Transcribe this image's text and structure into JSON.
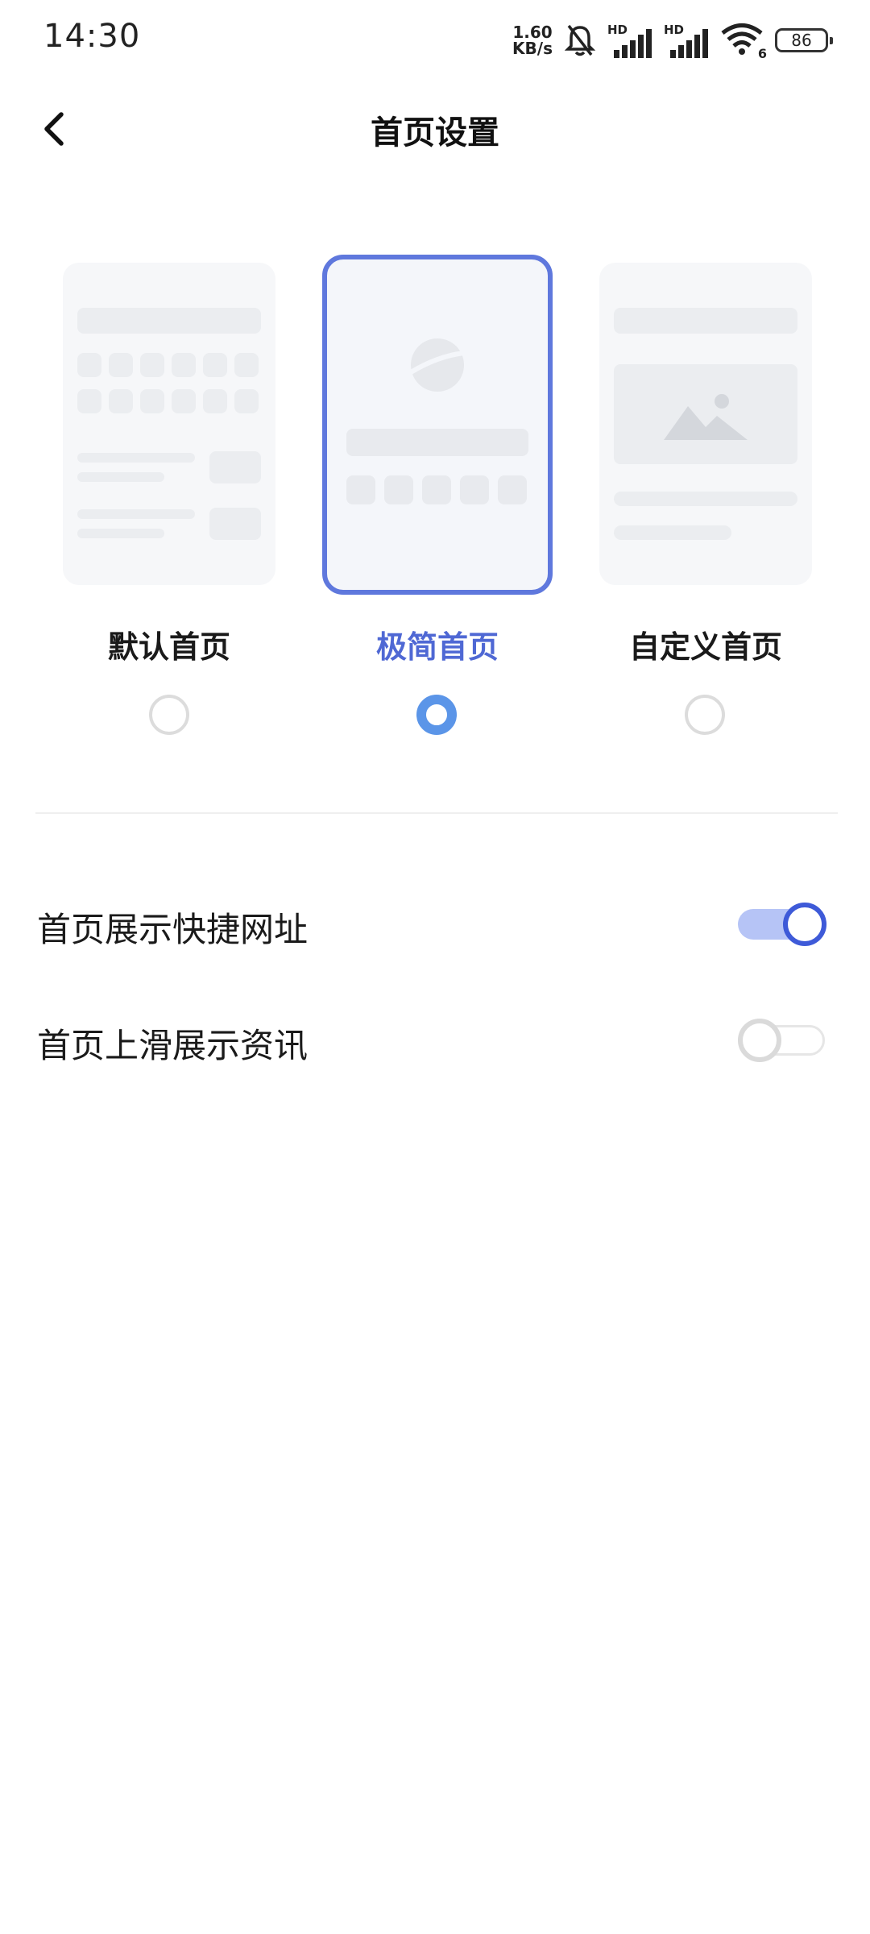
{
  "status_bar": {
    "time": "14:30",
    "net_speed_value": "1.60",
    "net_speed_unit": "KB/s",
    "signal1_label": "HD",
    "signal2_label": "HD",
    "wifi_badge": "6",
    "battery_level": "86",
    "icons": [
      "bell-muted-icon",
      "signal-icon",
      "signal-icon",
      "wifi-icon",
      "battery-icon"
    ]
  },
  "header": {
    "title": "首页设置",
    "back_icon": "chevron-left-icon"
  },
  "homepage_options": {
    "selected": "simple",
    "items": [
      {
        "id": "default",
        "label": "默认首页",
        "checked": false
      },
      {
        "id": "simple",
        "label": "极简首页",
        "checked": true
      },
      {
        "id": "custom",
        "label": "自定义首页",
        "checked": false
      }
    ]
  },
  "settings": [
    {
      "label": "首页展示快捷网址",
      "enabled": true
    },
    {
      "label": "首页上滑展示资讯",
      "enabled": false
    }
  ],
  "colors": {
    "accent": "#5f78dd",
    "radio_checked": "#5b95e8",
    "toggle_on_track": "#b6c4f6",
    "toggle_on_knob_border": "#3e5ad8"
  }
}
